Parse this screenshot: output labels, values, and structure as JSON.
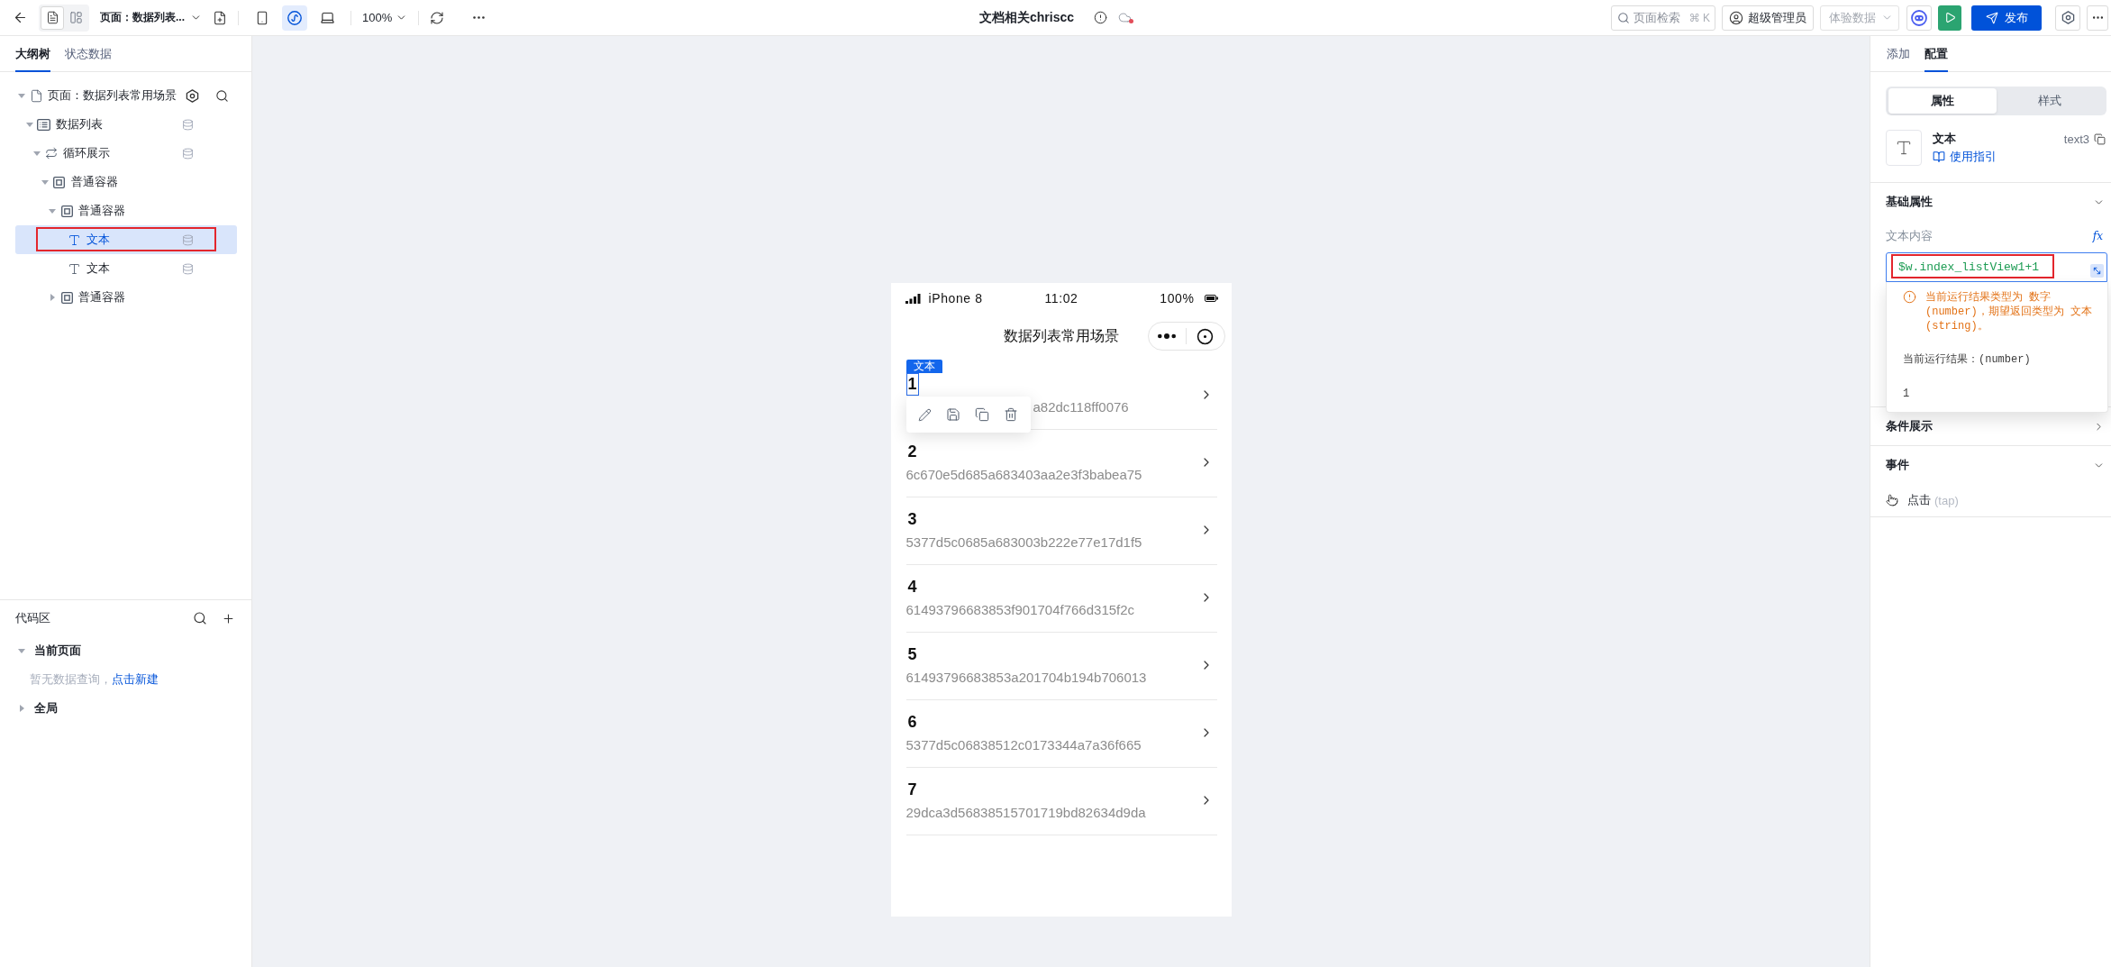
{
  "topbar": {
    "layout_toggles": [
      {
        "kind": "document",
        "selected": true
      },
      {
        "kind": "layout",
        "selected": false
      }
    ],
    "page_selector": "页面：数据列表...",
    "devices": [
      {
        "kind": "phone",
        "selected": false
      },
      {
        "kind": "mini_program",
        "selected": true
      },
      {
        "kind": "desktop",
        "selected": false
      }
    ],
    "zoom": "100%",
    "title": "文档相关chriscc",
    "search": {
      "placeholder": "页面检索",
      "shortcut": "⌘ K"
    },
    "user_role": "超级管理员",
    "data_mode": {
      "value": "体验数据",
      "disabled": true
    },
    "publish": "发布"
  },
  "outline_panel": {
    "tabs": [
      {
        "label": "大纲树",
        "selected": true
      },
      {
        "label": "状态数据",
        "selected": false
      }
    ],
    "tree": [
      {
        "kind": "page",
        "label": "页面：数据列表常用场景",
        "expanded": true,
        "selected": false,
        "data_bound": false,
        "highlighted": false,
        "children": [
          {
            "kind": "list",
            "label": "数据列表",
            "expanded": true,
            "selected": false,
            "data_bound": true,
            "highlighted": false,
            "children": [
              {
                "kind": "loop",
                "label": "循环展示",
                "expanded": true,
                "selected": false,
                "data_bound": true,
                "highlighted": false,
                "children": [
                  {
                    "kind": "container",
                    "label": "普通容器",
                    "expanded": true,
                    "selected": false,
                    "data_bound": false,
                    "highlighted": false,
                    "children": [
                      {
                        "kind": "container",
                        "label": "普通容器",
                        "expanded": true,
                        "selected": false,
                        "data_bound": false,
                        "highlighted": false,
                        "children": [
                          {
                            "kind": "text",
                            "label": "文本",
                            "selected": true,
                            "data_bound": true,
                            "highlighted": true
                          },
                          {
                            "kind": "text",
                            "label": "文本",
                            "selected": false,
                            "data_bound": true,
                            "highlighted": false
                          }
                        ]
                      },
                      {
                        "kind": "container",
                        "label": "普通容器",
                        "expanded": false,
                        "selected": false,
                        "data_bound": false,
                        "highlighted": false
                      }
                    ]
                  }
                ]
              }
            ]
          }
        ]
      }
    ]
  },
  "code_panel": {
    "title": "代码区",
    "groups": [
      {
        "label": "当前页面",
        "expanded": true,
        "empty_text": "暂无数据查询，",
        "action_link": "点击新建"
      },
      {
        "label": "全局",
        "expanded": false
      }
    ]
  },
  "phone": {
    "status_bar": {
      "device": "iPhone 8",
      "time": "11:02",
      "battery": "100%"
    },
    "nav_title": "数据列表常用场景",
    "selection_label": "文本",
    "items": [
      {
        "number": "1",
        "id": "a82dc118ff0076",
        "selected": true
      },
      {
        "number": "2",
        "id": "6c670e5d685a683403aa2e3f3babea75",
        "selected": false
      },
      {
        "number": "3",
        "id": "5377d5c0685a683003b222e77e17d1f5",
        "selected": false
      },
      {
        "number": "4",
        "id": "61493796683853f901704f766d315f2c",
        "selected": false
      },
      {
        "number": "5",
        "id": "61493796683853a201704b194b706013",
        "selected": false
      },
      {
        "number": "6",
        "id": "5377d5c06838512c0173344a7a36f665",
        "selected": false
      },
      {
        "number": "7",
        "id": "29dca3d56838515701719bd82634d9da",
        "selected": false
      }
    ]
  },
  "config_panel": {
    "tabs": [
      {
        "label": "添加",
        "selected": false
      },
      {
        "label": "配置",
        "selected": true
      }
    ],
    "mode_tabs": [
      {
        "label": "属性",
        "selected": true
      },
      {
        "label": "样式",
        "selected": false
      }
    ],
    "component": {
      "name": "文本",
      "guide_link": "使用指引",
      "id": "text3"
    },
    "sections": [
      {
        "kind": "fields",
        "title": "基础属性",
        "expanded": true,
        "field": {
          "label": "文本内容",
          "fx_label": "fx",
          "value": "$w.index_listView1+1",
          "highlighted": true,
          "popover": {
            "warning": "当前运行结果类型为 数字(number)，期望返回类型为 文本(string)。",
            "result_label": "当前运行结果：(number)",
            "result_value": "1"
          }
        }
      },
      {
        "title": "条件展示",
        "expanded": false
      },
      {
        "kind": "events",
        "title": "事件",
        "expanded": true,
        "events": [
          {
            "label": "点击",
            "hint": "(tap)"
          }
        ]
      }
    ]
  }
}
